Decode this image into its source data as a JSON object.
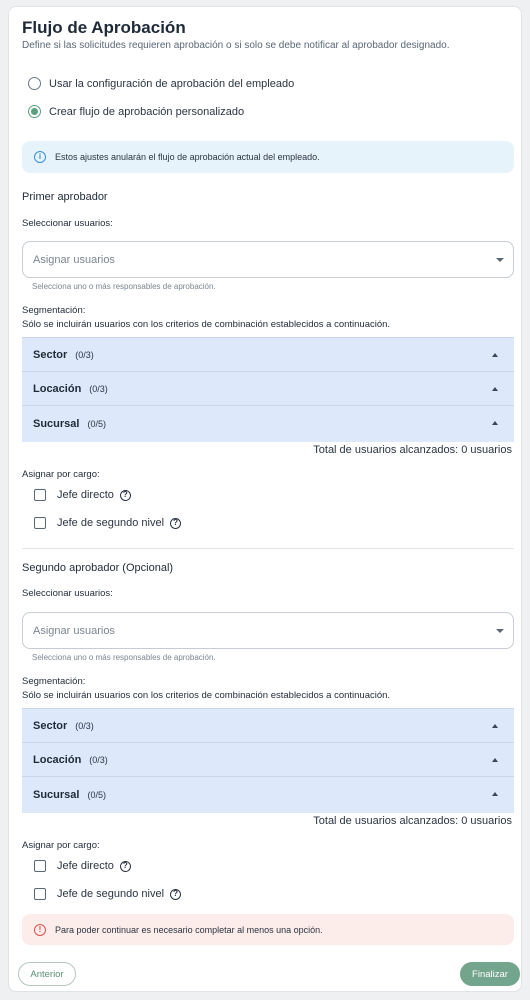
{
  "header": {
    "title": "Flujo de Aprobación",
    "subtitle": "Define si las solicitudes requieren aprobación o si solo se debe notificar al aprobador designado."
  },
  "options": {
    "employee_config": "Usar la configuración de aprobación del empleado",
    "custom_flow": "Crear flujo de aprobación personalizado",
    "selected": "custom_flow"
  },
  "info_message": "Estos ajustes anularán el flujo de aprobación actual del empleado.",
  "first_approver": {
    "title": "Primer aprobador",
    "select_label": "Seleccionar usuarios:",
    "select_placeholder": "Asignar usuarios",
    "select_helper": "Selecciona uno o más responsables de aprobación.",
    "segmentation_label": "Segmentación:",
    "segmentation_desc": "Sólo se incluirán usuarios con los criterios de combinación establecidos a continuación.",
    "segments": [
      {
        "name": "Sector",
        "count": "(0/3)"
      },
      {
        "name": "Locación",
        "count": "(0/3)"
      },
      {
        "name": "Sucursal",
        "count": "(0/5)"
      }
    ],
    "total": "Total de usuarios alcanzados: 0 usuarios",
    "role_label": "Asignar por cargo:",
    "roles": [
      {
        "label": "Jefe directo",
        "checked": false
      },
      {
        "label": "Jefe de segundo nivel",
        "checked": false
      }
    ]
  },
  "second_approver": {
    "title": "Segundo aprobador (Opcional)",
    "select_label": "Seleccionar usuarios:",
    "select_placeholder": "Asignar usuarios",
    "select_helper": "Selecciona uno o más responsables de aprobación.",
    "segmentation_label": "Segmentación:",
    "segmentation_desc": "Sólo se incluirán usuarios con los criterios de combinación establecidos a continuación.",
    "segments": [
      {
        "name": "Sector",
        "count": "(0/3)"
      },
      {
        "name": "Locación",
        "count": "(0/3)"
      },
      {
        "name": "Sucursal",
        "count": "(0/5)"
      }
    ],
    "total": "Total de usuarios alcanzados: 0 usuarios",
    "role_label": "Asignar por cargo:",
    "roles": [
      {
        "label": "Jefe directo",
        "checked": false
      },
      {
        "label": "Jefe de segundo nivel",
        "checked": false
      }
    ]
  },
  "error_message": "Para poder continuar es necesario completar al menos una opción.",
  "footer": {
    "prev_label": "Anterior",
    "finish_label": "Finalizar"
  },
  "colors": {
    "accent": "#73a48c",
    "info_bg": "#e7f3fb",
    "error_bg": "#fcecea",
    "accordion_bg": "#dde8fa"
  }
}
